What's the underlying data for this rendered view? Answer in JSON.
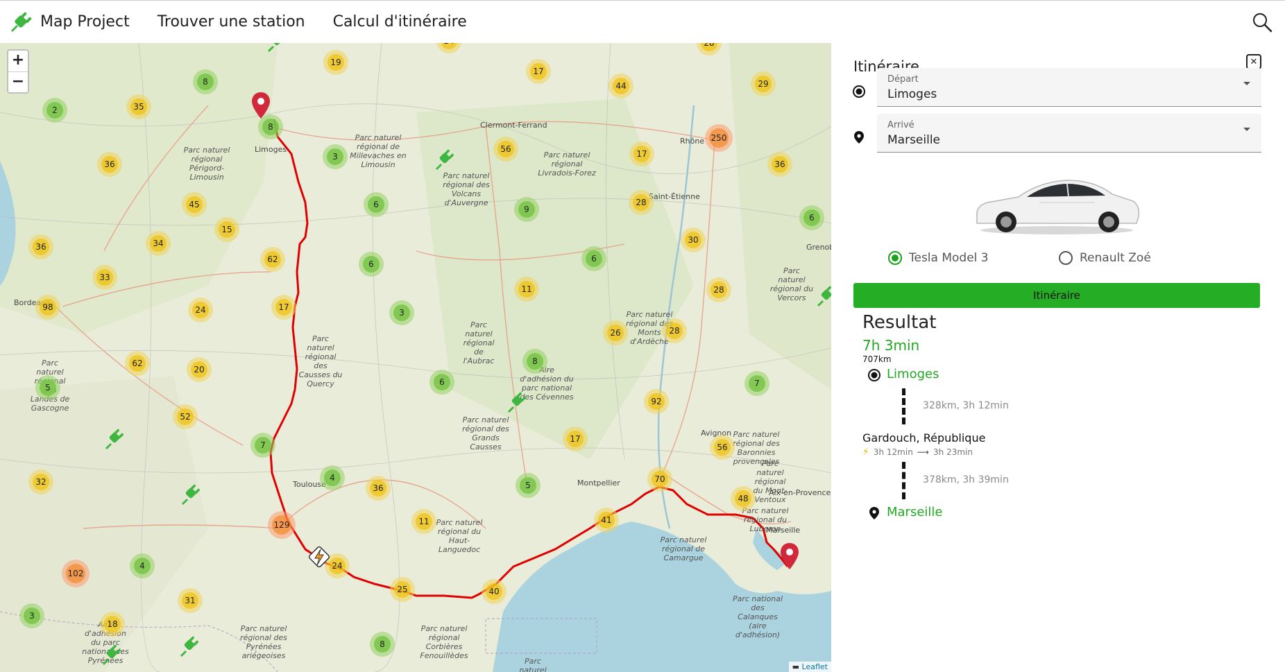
{
  "nav": {
    "brand": "Map Project",
    "links": [
      "Trouver une station",
      "Calcul d'itinéraire"
    ]
  },
  "map": {
    "zoom_in": "+",
    "zoom_out": "−",
    "attribution": "Leaflet",
    "clusters": [
      {
        "n": "19",
        "c": "yellow"
      },
      {
        "n": "24",
        "c": "yellow"
      },
      {
        "n": "17",
        "c": "yellow"
      },
      {
        "n": "28",
        "c": "yellow"
      },
      {
        "n": "8",
        "c": "green"
      },
      {
        "n": "2",
        "c": "green"
      },
      {
        "n": "35",
        "c": "yellow"
      },
      {
        "n": "44",
        "c": "yellow"
      },
      {
        "n": "29",
        "c": "yellow"
      },
      {
        "n": "8",
        "c": "green"
      },
      {
        "n": "3",
        "c": "green"
      },
      {
        "n": "56",
        "c": "yellow"
      },
      {
        "n": "17",
        "c": "yellow"
      },
      {
        "n": "250",
        "c": "orange"
      },
      {
        "n": "36",
        "c": "yellow"
      },
      {
        "n": "36",
        "c": "yellow"
      },
      {
        "n": "45",
        "c": "yellow"
      },
      {
        "n": "6",
        "c": "green"
      },
      {
        "n": "9",
        "c": "green"
      },
      {
        "n": "28",
        "c": "yellow"
      },
      {
        "n": "6",
        "c": "green"
      },
      {
        "n": "15",
        "c": "yellow"
      },
      {
        "n": "34",
        "c": "yellow"
      },
      {
        "n": "36",
        "c": "yellow"
      },
      {
        "n": "30",
        "c": "yellow"
      },
      {
        "n": "62",
        "c": "yellow"
      },
      {
        "n": "6",
        "c": "green"
      },
      {
        "n": "6",
        "c": "green"
      },
      {
        "n": "33",
        "c": "yellow"
      },
      {
        "n": "11",
        "c": "yellow"
      },
      {
        "n": "28",
        "c": "yellow"
      },
      {
        "n": "98",
        "c": "yellow"
      },
      {
        "n": "24",
        "c": "yellow"
      },
      {
        "n": "17",
        "c": "yellow"
      },
      {
        "n": "3",
        "c": "green"
      },
      {
        "n": "26",
        "c": "yellow"
      },
      {
        "n": "28",
        "c": "yellow"
      },
      {
        "n": "62",
        "c": "yellow"
      },
      {
        "n": "8",
        "c": "green"
      },
      {
        "n": "20",
        "c": "yellow"
      },
      {
        "n": "6",
        "c": "green"
      },
      {
        "n": "7",
        "c": "green"
      },
      {
        "n": "5",
        "c": "green"
      },
      {
        "n": "92",
        "c": "yellow"
      },
      {
        "n": "52",
        "c": "yellow"
      },
      {
        "n": "7",
        "c": "green"
      },
      {
        "n": "17",
        "c": "yellow"
      },
      {
        "n": "56",
        "c": "yellow"
      },
      {
        "n": "4",
        "c": "green"
      },
      {
        "n": "32",
        "c": "yellow"
      },
      {
        "n": "36",
        "c": "yellow"
      },
      {
        "n": "5",
        "c": "green"
      },
      {
        "n": "70",
        "c": "yellow"
      },
      {
        "n": "129",
        "c": "orange"
      },
      {
        "n": "11",
        "c": "yellow"
      },
      {
        "n": "41",
        "c": "yellow"
      },
      {
        "n": "48",
        "c": "yellow"
      },
      {
        "n": "4",
        "c": "green"
      },
      {
        "n": "24",
        "c": "yellow"
      },
      {
        "n": "102",
        "c": "orange"
      },
      {
        "n": "25",
        "c": "yellow"
      },
      {
        "n": "40",
        "c": "yellow"
      },
      {
        "n": "31",
        "c": "yellow"
      },
      {
        "n": "3",
        "c": "green"
      },
      {
        "n": "18",
        "c": "yellow"
      },
      {
        "n": "8",
        "c": "green"
      }
    ],
    "cities": [
      "Clermont-Ferrand",
      "Saint-Étienne",
      "Bordeaux",
      "Avignon",
      "Montpellier",
      "Aix-en-Provence",
      "Marseille",
      "Toulouse",
      "Limoges",
      "Rhône",
      "Grenoble"
    ],
    "parks": [
      "Parc naturel régional de Millevaches en Limousin",
      "Parc naturel régional Périgord-Limousin",
      "Parc naturel régional des Volcans d'Auvergne",
      "Parc naturel régional Livradois-Forez",
      "Parc naturel régional des Causses du Quercy",
      "Parc naturel régional de l'Aubrac",
      "Parc naturel régional des Monts d'Ardèche",
      "Parc naturel régional des Landes de Gascogne",
      "Aire d'adhésion du parc national des Cévennes",
      "Parc naturel régional des Grands Causses",
      "Parc naturel régional des Baronnies provençales",
      "Parc naturel régional du Mont-Ventoux",
      "Parc naturel régional du Luberon",
      "Parc naturel régional du Haut-Languedoc",
      "Parc naturel régional de Camargue",
      "Parc naturel régional du Vercors",
      "Parc naturel régional des Pyrénées ariégeoises",
      "Parc naturel régional Corbières Fenouillèdes",
      "Parc national des Calanques (aire d'adhésion)",
      "Aire d'adhésion du parc national des Pyrénées",
      "Parc naturel marin du golfe du Lion"
    ]
  },
  "panel": {
    "title": "Itinéraire",
    "close": "✕",
    "depart_label": "Départ",
    "depart_value": "Limoges",
    "arrive_label": "Arrivé",
    "arrive_value": "Marseille",
    "car_options": [
      "Tesla Model 3",
      "Renault Zoé"
    ],
    "selected_car": "Tesla Model 3",
    "button": "Itinéraire",
    "result": {
      "title": "Resultat",
      "duration": "7h 3min",
      "distance": "707km",
      "start": "Limoges",
      "segment1": "328km, 3h 12min",
      "stop_name": "Gardouch, République",
      "stop_arrive": "3h 12min",
      "stop_leave": "3h 23min",
      "segment2": "378km, 3h 39min",
      "end": "Marseille"
    }
  },
  "colors": {
    "accent_green": "#25ad25",
    "route_red": "#e00000",
    "cluster_green": "#78c446",
    "cluster_yellow": "#f0c20c",
    "cluster_orange": "#f18017"
  }
}
